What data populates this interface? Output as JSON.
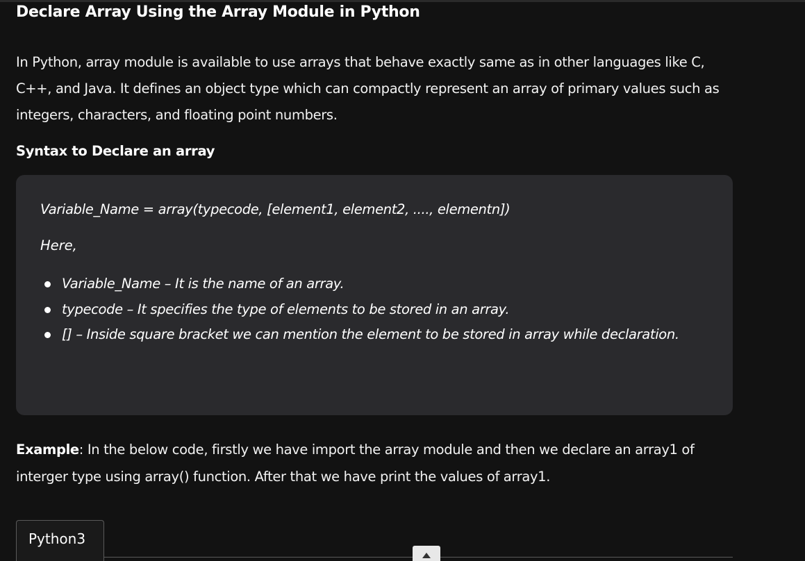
{
  "title": "Declare Array Using the Array Module in Python",
  "intro": "In Python, array module is available to use arrays that behave exactly same as in other languages like C, C++, and Java. It defines an object type which can compactly represent an array of primary values such as integers, characters, and floating point numbers.",
  "syntax_heading": "Syntax to Declare an array",
  "syntax_box": {
    "code_line": "Variable_Name = array(typecode, [element1, element2, ...., elementn])",
    "here_label": "Here,",
    "bullets": [
      "Variable_Name – It is the name of an array.",
      "typecode – It specifies the type of elements to be stored in an array.",
      "[] – Inside square bracket we can mention the element to be stored in array while declaration."
    ]
  },
  "example": {
    "label": "Example",
    "text": ": In the below code, firstly we have import the array module and then we declare an array1 of interger type using array() function. After that we have print the values of array1."
  },
  "code_tabs": [
    {
      "label": "Python3"
    }
  ],
  "icons": {
    "scroll_button": "chevron-up-icon"
  },
  "colors": {
    "background": "#121212",
    "box_background": "#2a2a2d",
    "text": "#ffffff"
  }
}
